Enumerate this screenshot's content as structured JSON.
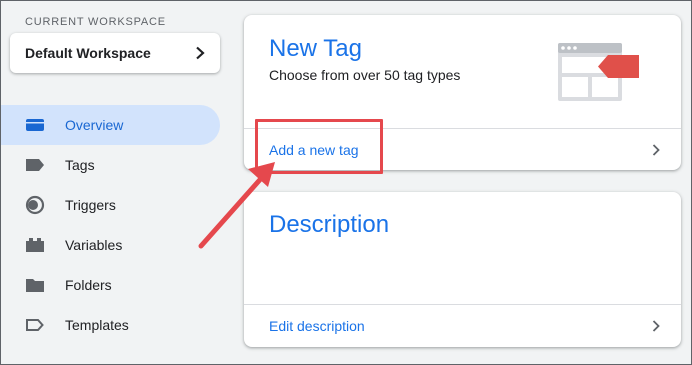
{
  "sidebar": {
    "workspace_label": "CURRENT WORKSPACE",
    "workspace_name": "Default Workspace",
    "items": [
      {
        "label": "Overview",
        "icon": "overview-icon",
        "active": true
      },
      {
        "label": "Tags",
        "icon": "tag-icon",
        "active": false
      },
      {
        "label": "Triggers",
        "icon": "trigger-icon",
        "active": false
      },
      {
        "label": "Variables",
        "icon": "variables-icon",
        "active": false
      },
      {
        "label": "Folders",
        "icon": "folder-icon",
        "active": false
      },
      {
        "label": "Templates",
        "icon": "template-icon",
        "active": false
      }
    ]
  },
  "new_tag_card": {
    "title": "New Tag",
    "subtitle": "Choose from over 50 tag types",
    "link": "Add a new tag",
    "illustration": "tag-illustration"
  },
  "description_card": {
    "title": "Description",
    "link": "Edit description"
  },
  "colors": {
    "accent": "#1a73e8",
    "active_bg": "#d2e3fc",
    "annotation": "#e5484d"
  }
}
